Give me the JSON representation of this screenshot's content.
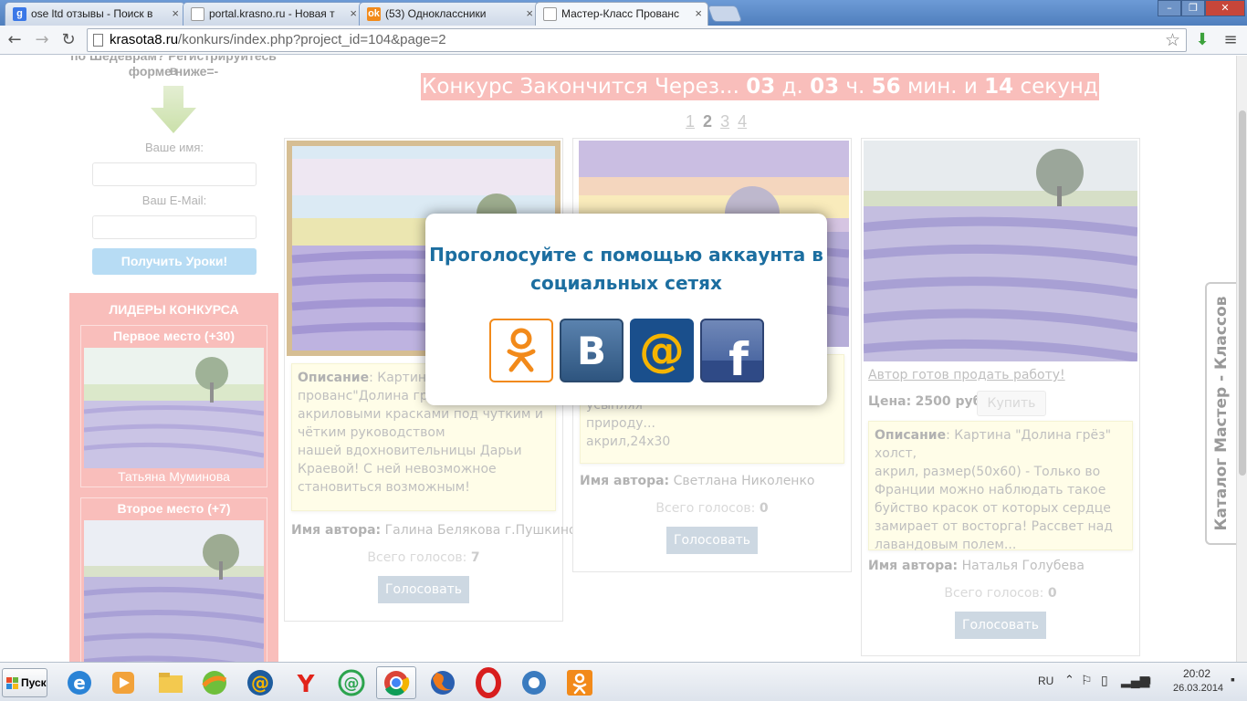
{
  "browser": {
    "tabs": [
      {
        "title": "ose ltd отзывы - Поиск в",
        "icon": "google-icon",
        "color": "#3b78e7",
        "glyph": "g"
      },
      {
        "title": "portal.krasno.ru - Новая т",
        "icon": "page-icon",
        "color": "#9aa8b8",
        "glyph": ""
      },
      {
        "title": "(53) Одноклассники",
        "icon": "odnoklassniki-icon",
        "color": "#f28a1a",
        "glyph": "ok"
      },
      {
        "title": "Мастер-Класс Прованс",
        "icon": "page-icon",
        "color": "#9aa8b8",
        "glyph": ""
      }
    ],
    "url_host": "krasota8.ru",
    "url_path": "/konkurs/index.php?project_id=104&page=2"
  },
  "sidebar": {
    "intro_line1": "по Шедеврам? Регистрируйтесь в",
    "intro_line2": "форме ниже=-",
    "name_label": "Ваше имя:",
    "email_label": "Ваш E-Mail:",
    "submit_label": "Получить Уроки!",
    "leaders_title": "ЛИДЕРЫ КОНКУРСА",
    "first_place": "Первое место (+30)",
    "first_name": "Татьяна Муминова",
    "second_place": "Второе место (+7)"
  },
  "countdown": {
    "prefix": "Конкурс Закончится Через...",
    "days": "03",
    "days_unit": "д.",
    "hours": "03",
    "hours_unit": "ч.",
    "minutes": "56",
    "minutes_unit": "мин. и",
    "seconds": "14",
    "seconds_unit": "секунд"
  },
  "pager": {
    "p1": "1",
    "p2": "2",
    "p3": "3",
    "p4": "4"
  },
  "cards": [
    {
      "desc_label": "Описание",
      "desc_lines": [
        ": Картина н",
        "прованс\"Долина грёз\" написана",
        "акриловыми красками под чутким и",
        "чётким руководством",
        "нашей вдохновительницы Дарьи",
        "Краевой! С ней невозможное",
        "становиться возможным!"
      ],
      "author_label": "Имя автора:",
      "author": "Галина Белякова г.Пушкино",
      "votes_label": "Всего голосов:",
      "votes": "7",
      "vote_button": "Голосовать"
    },
    {
      "desc_lines": [
        "лучиками солнца...укутывая и усыпляя",
        "природу...",
        "акрил,24х30"
      ],
      "author_label": "Имя автора:",
      "author": "Светлана Николенко",
      "votes_label": "Всего голосов:",
      "votes": "0",
      "vote_button": "Голосовать"
    },
    {
      "sell_link": "Автор готов продать работу!",
      "price_label": "Цена:",
      "price": "2500 руб.",
      "buy_button": "Купить",
      "desc_label": "Описание",
      "desc_lines": [
        ": Картина \"Долина грёз\" холст,",
        "акрил, размер(50х60) - Только во",
        "Франции можно наблюдать такое",
        "буйство красок от которых сердце",
        "замирает от восторга! Рассвет над",
        "лавандовым полем..."
      ],
      "author_label": "Имя автора:",
      "author": "Наталья Голубева",
      "votes_label": "Всего голосов:",
      "votes": "0",
      "vote_button": "Голосовать"
    }
  ],
  "modal": {
    "title_line1": "Проголосуйте с помощью аккаунта в",
    "title_line2": "социальных сетях",
    "social": [
      {
        "name": "odnoklassniki-login-button",
        "icon": "odnoklassniki-icon"
      },
      {
        "name": "vkontakte-login-button",
        "icon": "vkontakte-icon",
        "glyph": "B"
      },
      {
        "name": "mailru-login-button",
        "icon": "mailru-icon",
        "glyph": "@"
      },
      {
        "name": "facebook-login-button",
        "icon": "facebook-icon",
        "glyph": "f"
      }
    ]
  },
  "catalog_tab": "Каталог Мастер - Классов",
  "taskbar": {
    "start_label": "Пуск",
    "lang": "RU",
    "time": "20:02",
    "date": "26.03.2014"
  },
  "colors": {
    "accent_pink": "#f7a8a4",
    "modal_title": "#1c6ea0",
    "ok_orange": "#f28a1a",
    "vk_blue": "#3f6797",
    "mailru_navy": "#1a4f8c",
    "fb_blue": "#3b5998"
  }
}
